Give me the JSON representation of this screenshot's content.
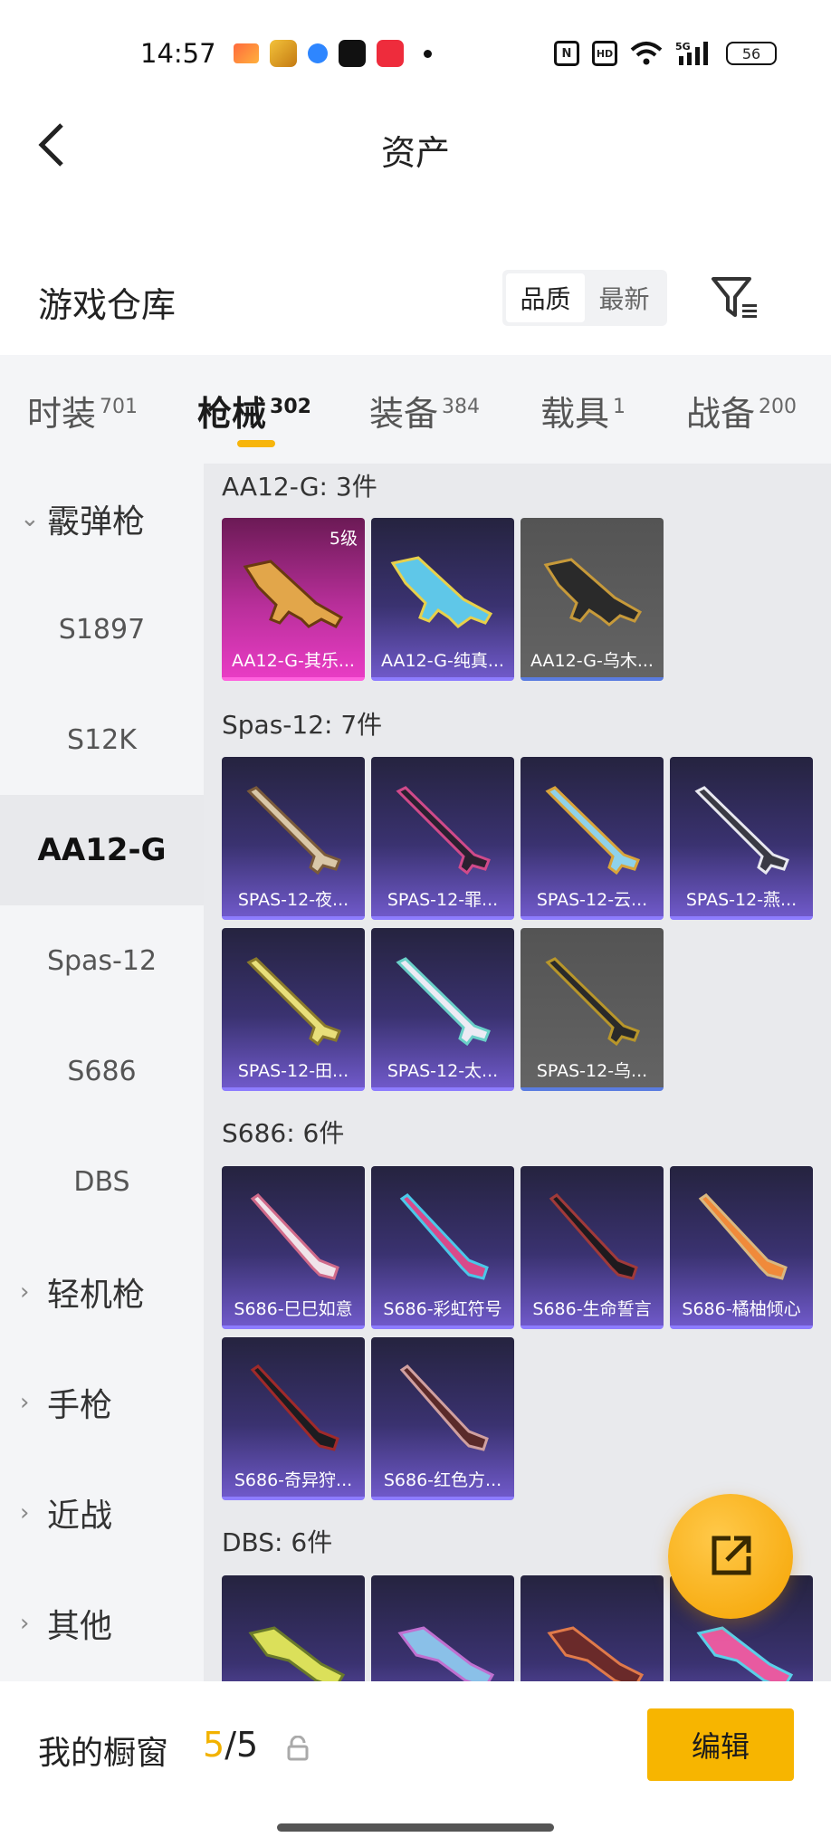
{
  "status_bar": {
    "time": "14:57",
    "battery": "56"
  },
  "header": {
    "title": "资产"
  },
  "warehouse": {
    "title": "游戏仓库",
    "sort_options": [
      {
        "label": "品质",
        "active": true
      },
      {
        "label": "最新",
        "active": false
      }
    ]
  },
  "tabs": [
    {
      "label": "时装",
      "count": "701"
    },
    {
      "label": "枪械",
      "count": "302",
      "active": true
    },
    {
      "label": "装备",
      "count": "384"
    },
    {
      "label": "载具",
      "count": "1"
    },
    {
      "label": "战备",
      "count": "200"
    }
  ],
  "sidebar": {
    "categories": [
      {
        "label": "霰弹枪",
        "expanded": true
      },
      {
        "label": "轻机枪"
      },
      {
        "label": "手枪"
      },
      {
        "label": "近战"
      },
      {
        "label": "其他"
      }
    ],
    "subitems": [
      "S1897",
      "S12K",
      "AA12-G",
      "Spas-12",
      "S686",
      "DBS"
    ],
    "selected": "AA12-G"
  },
  "groups": [
    {
      "title": "AA12-G: 3件",
      "items": [
        {
          "name": "AA12-G-其乐...",
          "rarity": "pink",
          "level": "5级"
        },
        {
          "name": "AA12-G-纯真...",
          "rarity": "purple"
        },
        {
          "name": "AA12-G-乌木...",
          "rarity": "gray"
        }
      ]
    },
    {
      "title": "Spas-12: 7件",
      "items": [
        {
          "name": "SPAS-12-夜...",
          "rarity": "purple"
        },
        {
          "name": "SPAS-12-罪...",
          "rarity": "purple"
        },
        {
          "name": "SPAS-12-云...",
          "rarity": "purple"
        },
        {
          "name": "SPAS-12-燕...",
          "rarity": "purple"
        },
        {
          "name": "SPAS-12-田...",
          "rarity": "purple"
        },
        {
          "name": "SPAS-12-太...",
          "rarity": "purple"
        },
        {
          "name": "SPAS-12-乌...",
          "rarity": "gray"
        }
      ]
    },
    {
      "title": "S686: 6件",
      "items": [
        {
          "name": "S686-巳巳如意",
          "rarity": "purple"
        },
        {
          "name": "S686-彩虹符号",
          "rarity": "purple"
        },
        {
          "name": "S686-生命誓言",
          "rarity": "purple"
        },
        {
          "name": "S686-橘柚倾心",
          "rarity": "purple"
        },
        {
          "name": "S686-奇异狩...",
          "rarity": "purple"
        },
        {
          "name": "S686-红色方...",
          "rarity": "purple"
        }
      ]
    },
    {
      "title": "DBS: 6件",
      "items": []
    }
  ],
  "bottom_bar": {
    "showcase_label": "我的橱窗",
    "showcase_current": "5",
    "showcase_total": "/5",
    "edit_label": "编辑"
  }
}
